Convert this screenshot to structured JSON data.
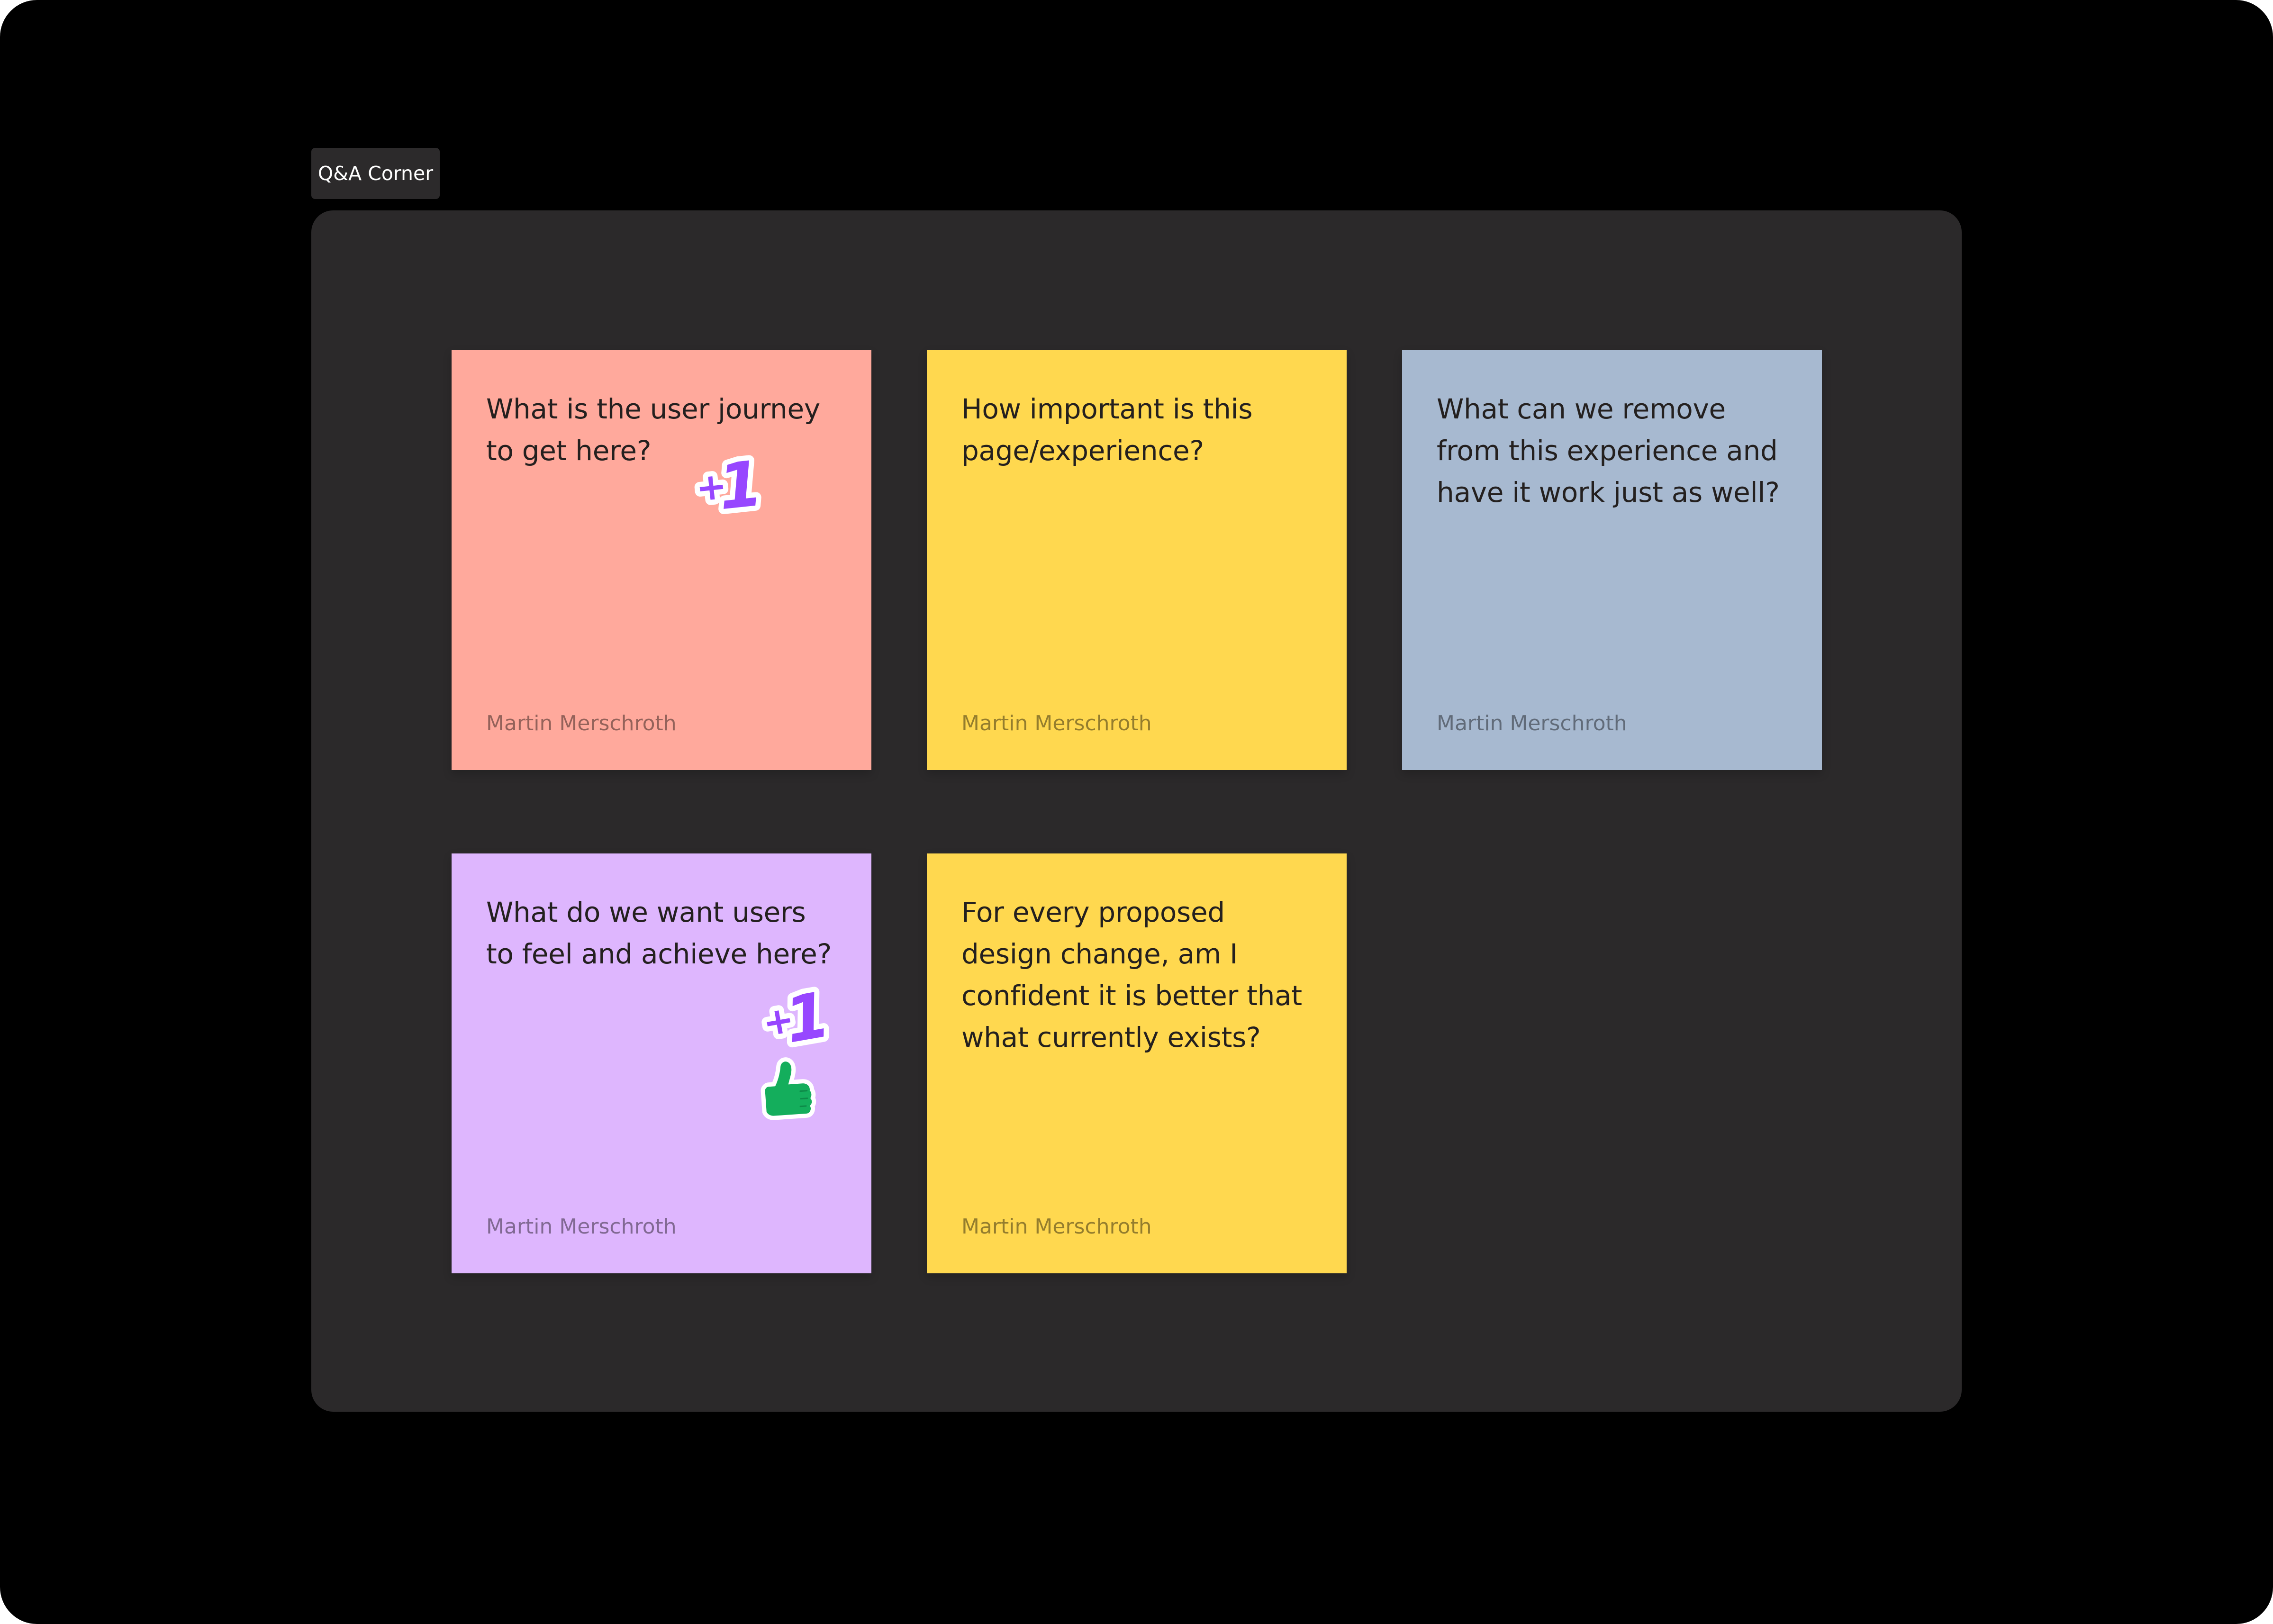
{
  "section": {
    "title": "Q&A Corner"
  },
  "colors": {
    "background": "#000000",
    "section": "#2b292a",
    "label": "#2c2a2b",
    "salmon": "#ffa99c",
    "yellow": "#ffd84f",
    "blue": "#a7b9d0",
    "lavender": "#deb6fe",
    "sticker_purple": "#9747ff",
    "sticker_green": "#14ae5c"
  },
  "stickies": [
    {
      "question": "What is the user journey to get here?",
      "author": "Martin Merschroth",
      "color": "#ffa99c",
      "stickers": [
        "plus-one-sticker"
      ]
    },
    {
      "question": "How important is this page/experience?",
      "author": "Martin Merschroth",
      "color": "#ffd84f",
      "stickers": []
    },
    {
      "question": "What can we remove from this experience and have it work just as well?",
      "author": "Martin Merschroth",
      "color": "#a7b9d0",
      "stickers": []
    },
    {
      "question": "What do we want users to feel and achieve here?",
      "author": "Martin Merschroth",
      "color": "#deb6fe",
      "stickers": [
        "plus-one-sticker",
        "thumbs-up-sticker"
      ]
    },
    {
      "question": "For every proposed design change, am I confident it is better that what currently exists?",
      "author": "Martin Merschroth",
      "color": "#ffd84f",
      "stickers": []
    }
  ]
}
